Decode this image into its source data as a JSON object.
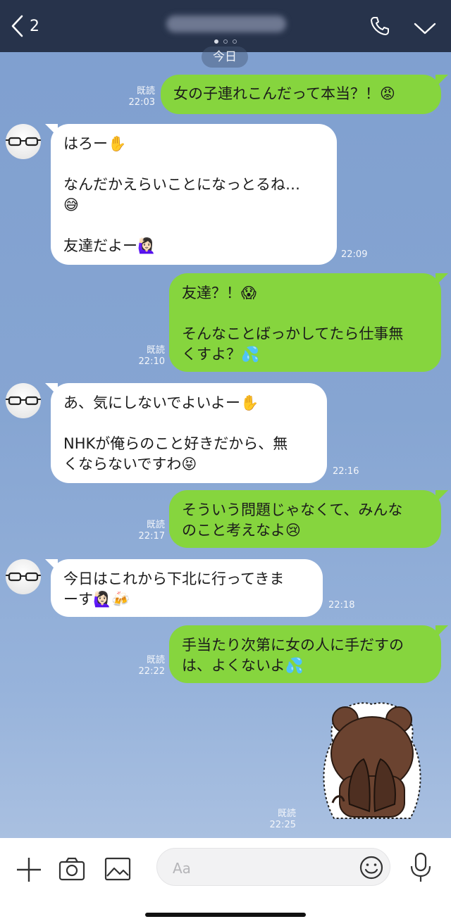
{
  "header": {
    "back_count": "2",
    "pager": {
      "pages": 3,
      "active": 1
    }
  },
  "date_separator": "今日",
  "messages": [
    {
      "id": "m1",
      "direction": "out",
      "lines": [
        "女の子連れこんだって本当？！😡"
      ],
      "read": "既読",
      "time": "22:03"
    },
    {
      "id": "m2",
      "direction": "in",
      "lines": [
        "はろー✋",
        "",
        "なんだかえらいことになっとるね…",
        "😅",
        "",
        "友達だよー🙋🏻‍♀️"
      ],
      "time": "22:09"
    },
    {
      "id": "m3",
      "direction": "out",
      "lines": [
        "友達？！😱",
        "",
        "そんなことばっかしてたら仕事無",
        "くすよ？💦"
      ],
      "read": "既読",
      "time": "22:10"
    },
    {
      "id": "m4",
      "direction": "in",
      "lines": [
        "あ、気にしないでよいよー✋",
        "",
        "NHKが俺らのこと好きだから、無",
        "くならないですわ😝"
      ],
      "time": "22:16"
    },
    {
      "id": "m5",
      "direction": "out",
      "lines": [
        "そういう問題じゃなくて、みんな",
        "のこと考えなよ😢"
      ],
      "read": "既読",
      "time": "22:17"
    },
    {
      "id": "m6",
      "direction": "in",
      "lines": [
        "今日はこれから下北に行ってきま",
        "ーす🙋🏻‍♀️🍻"
      ],
      "time": "22:18"
    },
    {
      "id": "m7",
      "direction": "out",
      "lines": [
        "手当たり次第に女の人に手だすの",
        "は、よくないよ💦"
      ],
      "read": "既読",
      "time": "22:22"
    }
  ],
  "sticker_message": {
    "read": "既読",
    "time": "22:25",
    "sticker": "brown-bear-covering-face-sticker"
  },
  "input": {
    "placeholder": "Aa",
    "value": ""
  },
  "colors": {
    "header": "#27334b",
    "bubble_out": "#86d53e",
    "bubble_in": "#ffffff",
    "background": "#86a5d2"
  },
  "icons": [
    "back-chevron-icon",
    "phone-icon",
    "chevron-down-icon",
    "plus-icon",
    "camera-icon",
    "image-icon",
    "emoji-icon",
    "microphone-icon"
  ]
}
